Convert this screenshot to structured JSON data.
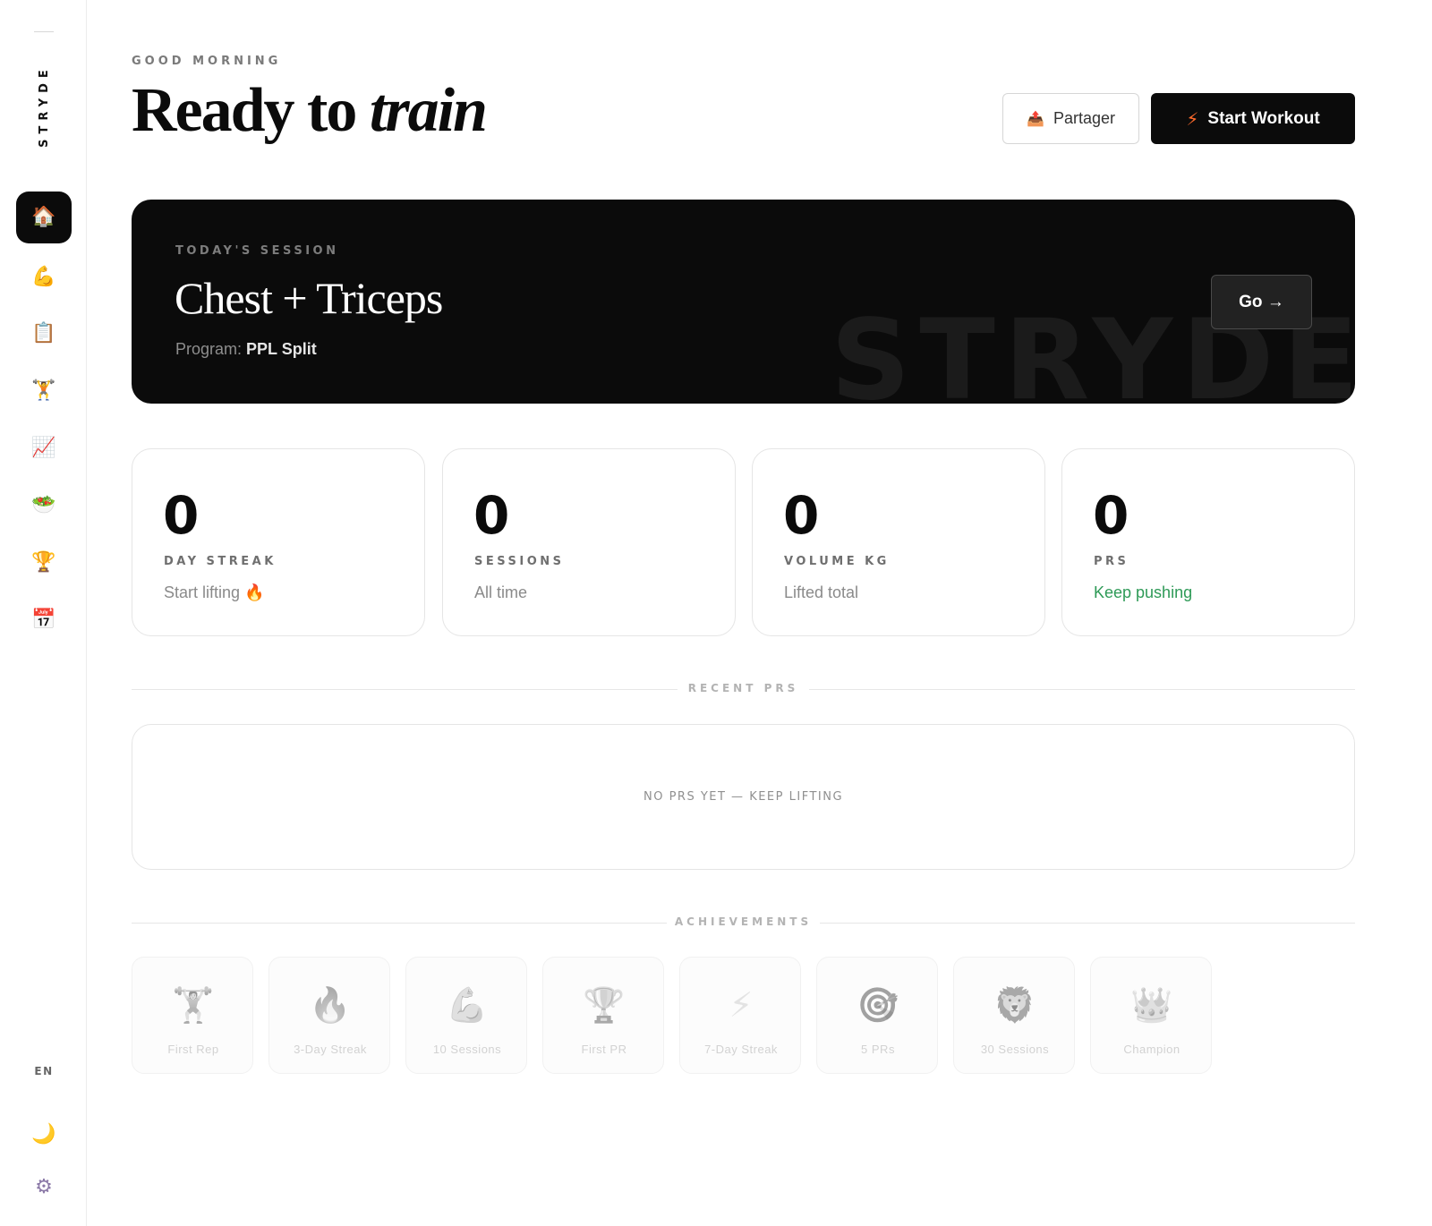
{
  "sidebar": {
    "brand": "STRYDE",
    "nav": [
      {
        "icon": "🏠",
        "name": "home-icon",
        "active": true
      },
      {
        "icon": "💪",
        "name": "flexed-biceps-icon",
        "active": false
      },
      {
        "icon": "📋",
        "name": "clipboard-icon",
        "active": false
      },
      {
        "icon": "🏋",
        "name": "weightlifter-icon",
        "active": false
      },
      {
        "icon": "📈",
        "name": "chart-increasing-icon",
        "active": false
      },
      {
        "icon": "🥗",
        "name": "salad-icon",
        "active": false
      },
      {
        "icon": "🏆",
        "name": "trophy-icon",
        "active": false
      },
      {
        "icon": "📅",
        "name": "calendar-icon",
        "active": false
      }
    ],
    "language": "EN",
    "theme_icon": "🌙",
    "settings_icon": "⚙"
  },
  "header": {
    "greeting": "GOOD MORNING",
    "title_plain": "Ready to ",
    "title_italic": "train",
    "share_icon": "📤",
    "share_label": "Partager",
    "start_icon": "⚡",
    "start_label": "Start Workout"
  },
  "session": {
    "label": "TODAY'S SESSION",
    "name": "Chest + Triceps",
    "program_prefix": "Program: ",
    "program_name": "PPL Split",
    "watermark": "STRYDE",
    "go_label": "Go →"
  },
  "stats": [
    {
      "value": "0",
      "label": "DAY STREAK",
      "sub": "Start lifting",
      "sub_icon": "🔥",
      "sub_color": "default"
    },
    {
      "value": "0",
      "label": "SESSIONS",
      "sub": "All time",
      "sub_icon": "",
      "sub_color": "default"
    },
    {
      "value": "0",
      "label": "VOLUME KG",
      "sub": "Lifted total",
      "sub_icon": "",
      "sub_color": "default"
    },
    {
      "value": "0",
      "label": "PRS",
      "sub": "Keep pushing",
      "sub_icon": "",
      "sub_color": "green"
    }
  ],
  "recent_prs": {
    "heading": "RECENT PRS",
    "empty": "NO PRS YET — KEEP LIFTING"
  },
  "achievements": {
    "heading": "ACHIEVEMENTS",
    "items": [
      {
        "icon": "🏋",
        "label": "First Rep"
      },
      {
        "icon": "🔥",
        "label": "3-Day Streak"
      },
      {
        "icon": "💪",
        "label": "10 Sessions"
      },
      {
        "icon": "🏆",
        "label": "First PR"
      },
      {
        "icon": "⚡",
        "label": "7-Day Streak"
      },
      {
        "icon": "🎯",
        "label": "5 PRs"
      },
      {
        "icon": "🦁",
        "label": "30 Sessions"
      },
      {
        "icon": "👑",
        "label": "Champion"
      }
    ]
  },
  "colors": {
    "accent_dark": "#0b0b0b",
    "bolt": "#ff6a2b",
    "positive": "#2e9a57"
  }
}
